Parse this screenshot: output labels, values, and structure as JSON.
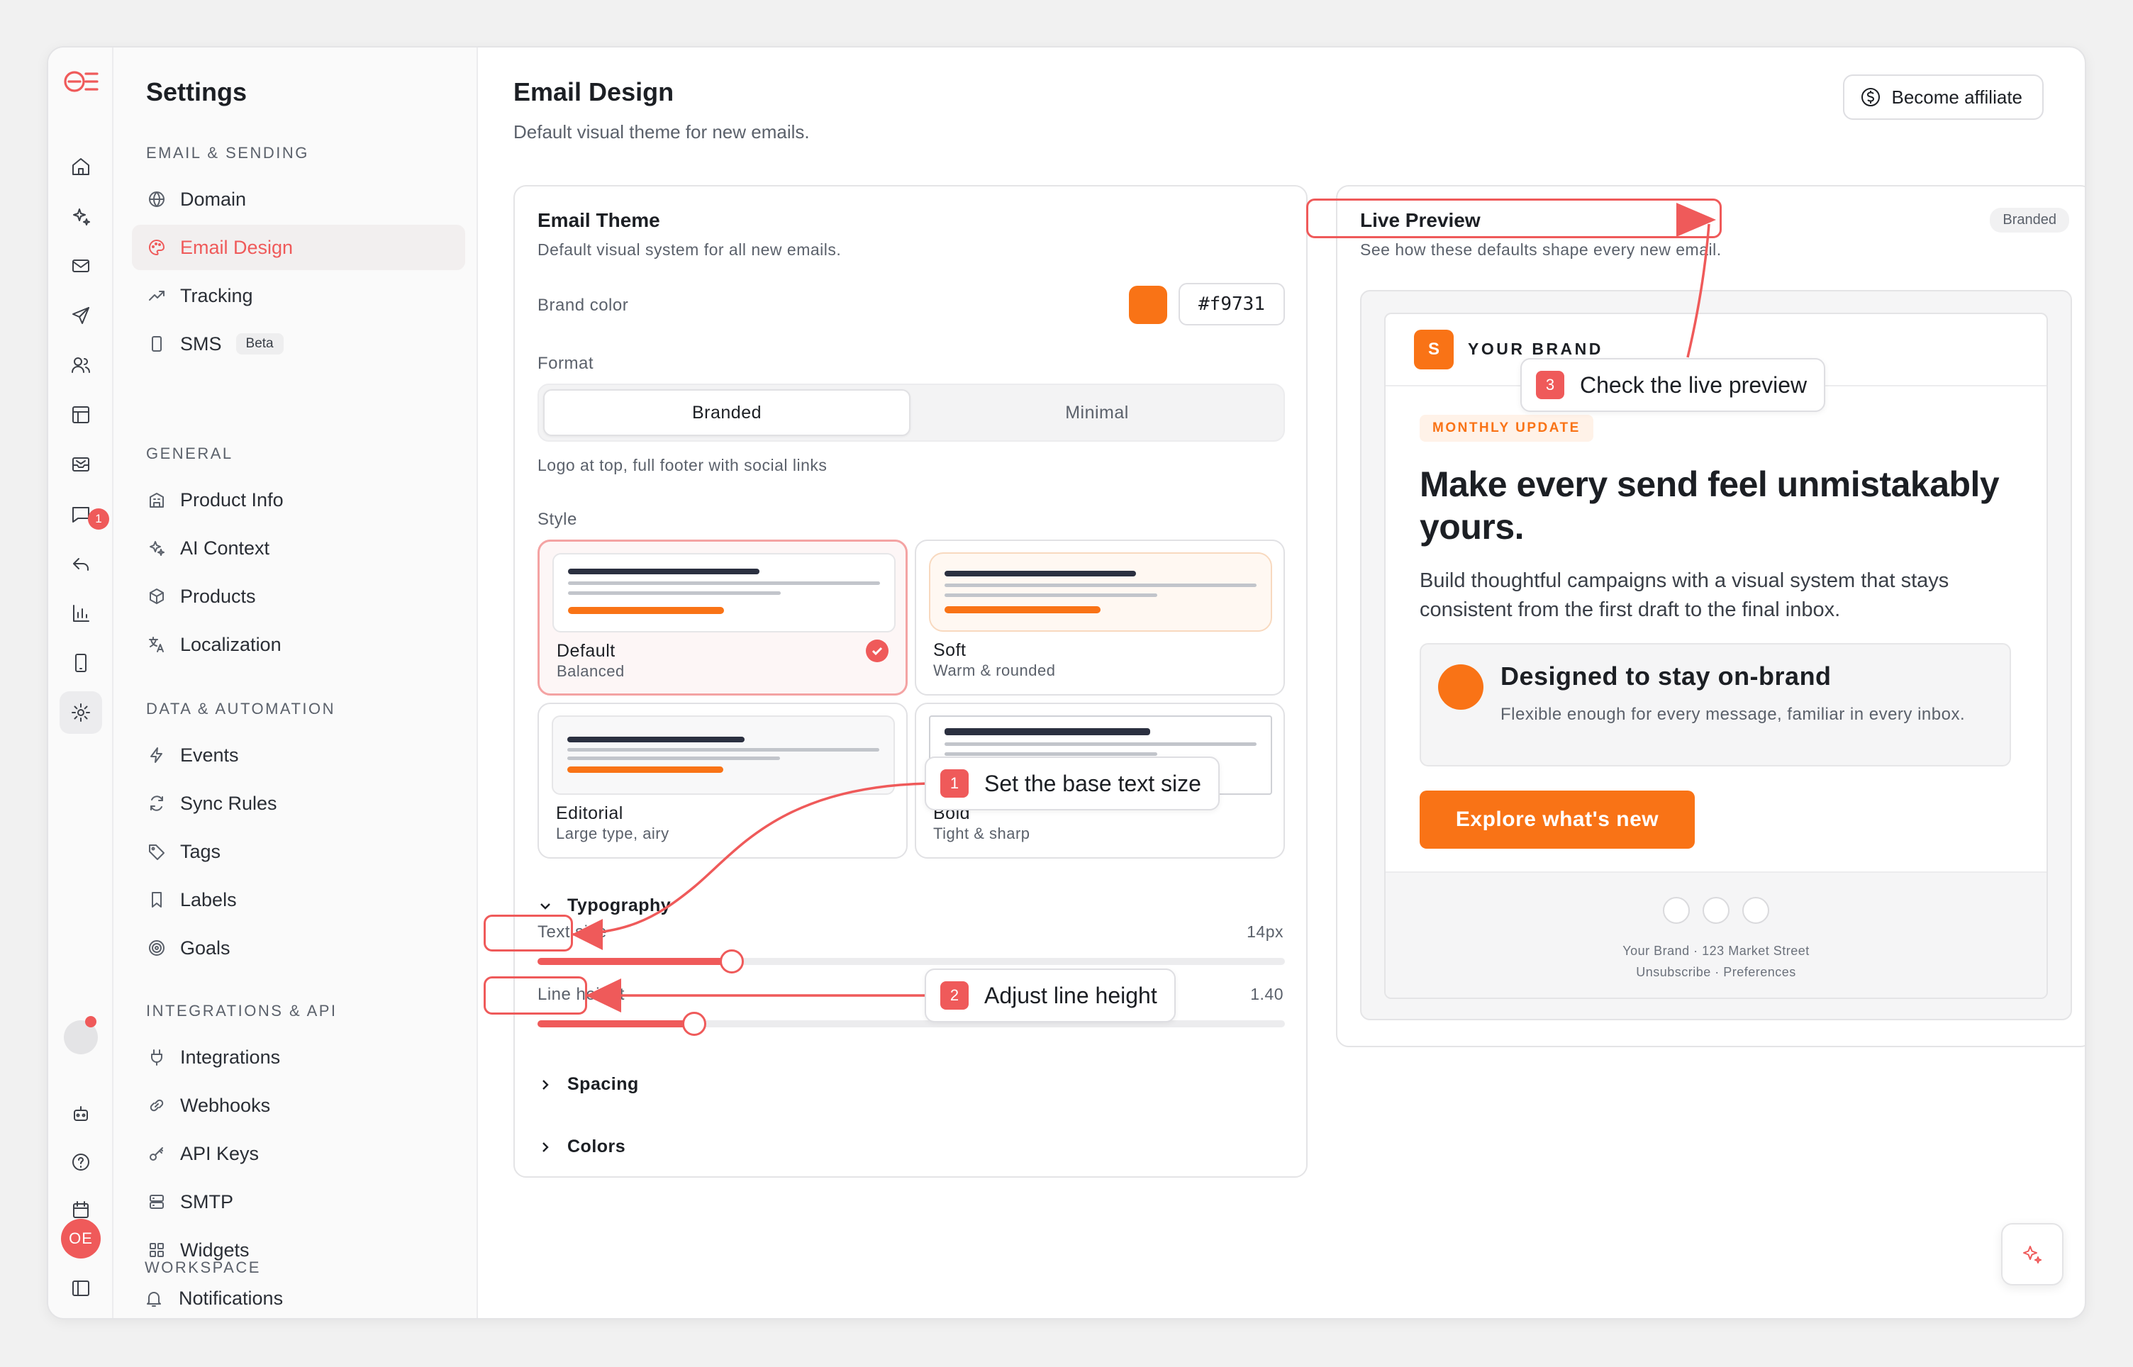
{
  "rail": {
    "notification_count": "1",
    "avatar_initials": "OE"
  },
  "sidebar": {
    "title": "Settings",
    "sections": {
      "email_sending": "EMAIL & SENDING",
      "general": "GENERAL",
      "data_automation": "DATA & AUTOMATION",
      "integrations_api": "INTEGRATIONS & API",
      "workspace": "WORKSPACE"
    },
    "items": {
      "domain": "Domain",
      "email_design": "Email Design",
      "tracking": "Tracking",
      "sms": "SMS",
      "sms_badge": "Beta",
      "product_info": "Product Info",
      "ai_context": "AI Context",
      "products": "Products",
      "localization": "Localization",
      "events": "Events",
      "sync_rules": "Sync Rules",
      "tags": "Tags",
      "labels": "Labels",
      "goals": "Goals",
      "integrations": "Integrations",
      "webhooks": "Webhooks",
      "api_keys": "API Keys",
      "smtp": "SMTP",
      "widgets": "Widgets",
      "notifications": "Notifications"
    }
  },
  "header": {
    "title": "Email Design",
    "subtitle": "Default visual theme for new emails.",
    "affiliate_label": "Become affiliate"
  },
  "theme": {
    "title": "Email Theme",
    "subtitle": "Default visual system for all new emails.",
    "brand_color_label": "Brand color",
    "brand_color": "#f97316",
    "brand_color_hex": "#f9731",
    "format_label": "Format",
    "format_options": [
      "Branded",
      "Minimal"
    ],
    "format_selected": "Branded",
    "format_hint": "Logo at top, full footer with social links",
    "style_label": "Style",
    "styles": [
      {
        "name": "Default",
        "desc": "Balanced",
        "selected": true
      },
      {
        "name": "Soft",
        "desc": "Warm & rounded",
        "selected": false
      },
      {
        "name": "Editorial",
        "desc": "Large type, airy",
        "selected": false
      },
      {
        "name": "Bold",
        "desc": "Tight & sharp",
        "selected": false
      }
    ],
    "typography_label": "Typography",
    "text_size_label": "Text size",
    "text_size_value": "14px",
    "text_size_fraction": 0.26,
    "line_height_label": "Line height",
    "line_height_value": "1.40",
    "line_height_fraction": 0.21,
    "spacing_label": "Spacing",
    "colors_label": "Colors"
  },
  "preview": {
    "title": "Live Preview",
    "subtitle": "See how these defaults shape every new email.",
    "badge": "Branded",
    "brand_initial": "S",
    "brand_name": "YOUR BRAND",
    "eyebrow": "MONTHLY UPDATE",
    "headline": "Make every send feel unmistakably yours.",
    "body": "Build thoughtful campaigns with a visual system that stays consistent from the first draft to the final inbox.",
    "feature_title": "Designed to stay on-brand",
    "feature_desc": "Flexible enough for every message, familiar in every inbox.",
    "cta_label": "Explore what's new",
    "footer_address": "Your Brand · 123 Market Street",
    "footer_links": "Unsubscribe · Preferences"
  },
  "annotations": {
    "step1_num": "1",
    "step1_text": "Set the base text size",
    "step2_num": "2",
    "step2_text": "Adjust line height",
    "step3_num": "3",
    "step3_text": "Check the live preview",
    "accent_color": "#ef5a5a"
  }
}
